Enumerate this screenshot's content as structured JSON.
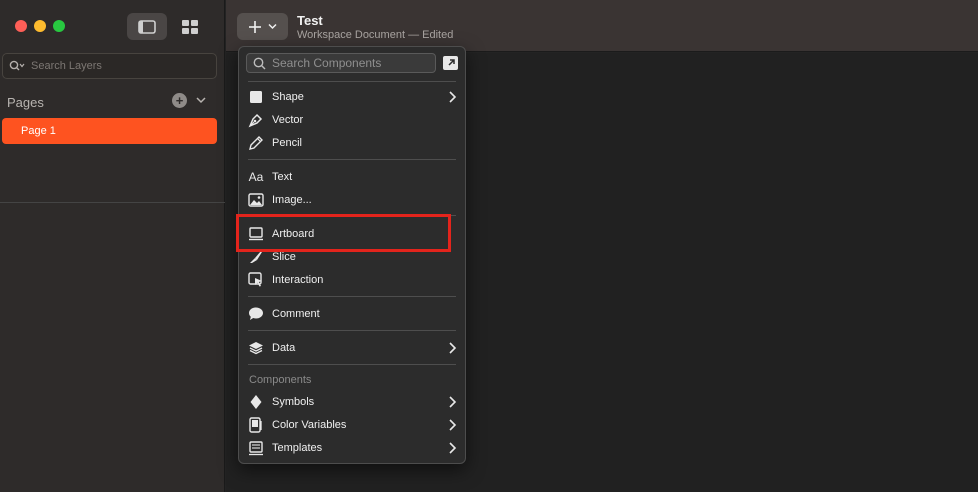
{
  "sidebar": {
    "view_buttons": [
      "single-page-view",
      "grid-view"
    ],
    "search_placeholder": "Search Layers",
    "pages_title": "Pages",
    "add_page_glyph": "+",
    "pages": [
      {
        "label": "Page 1",
        "selected": true
      }
    ]
  },
  "toolbar": {
    "insert_glyph": "+",
    "doc_title": "Test",
    "doc_subtitle": "Workspace Document — Edited"
  },
  "menu": {
    "search_placeholder": "Search Components",
    "items": {
      "shape": "Shape",
      "vector": "Vector",
      "pencil": "Pencil",
      "text": "Text",
      "text_icon": "Aa",
      "image": "Image...",
      "artboard": "Artboard",
      "slice": "Slice",
      "interaction": "Interaction",
      "comment": "Comment",
      "data": "Data",
      "components_header": "Components",
      "symbols": "Symbols",
      "color_variables": "Color Variables",
      "templates": "Templates"
    }
  },
  "colors": {
    "accent": "#fe5320",
    "highlight": "#e3241c"
  }
}
